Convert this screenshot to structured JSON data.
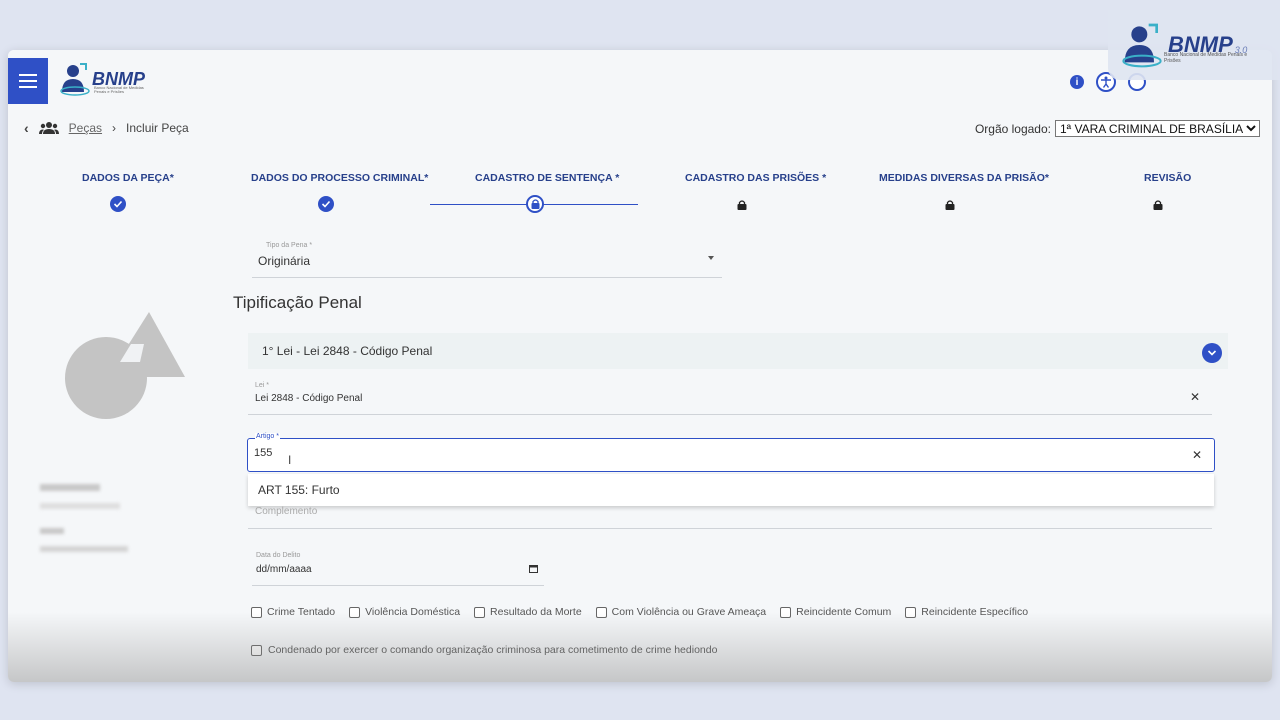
{
  "brand": {
    "name": "BNMP",
    "subtitle": "Banco Nacional de Medidas Penais e Prisões",
    "version": "3.0"
  },
  "header": {
    "info_icon": "i"
  },
  "breadcrumb": {
    "items": [
      "Peças",
      "Incluir Peça"
    ]
  },
  "orgao": {
    "label": "Orgão logado:",
    "selected": "1ª VARA CRIMINAL DE BRASÍLIA"
  },
  "stepper": {
    "steps": [
      {
        "label": "DADOS DA PEÇA*",
        "state": "done"
      },
      {
        "label": "DADOS DO PROCESSO CRIMINAL*",
        "state": "done"
      },
      {
        "label": "CADASTRO DE SENTENÇA *",
        "state": "active"
      },
      {
        "label": "CADASTRO DAS PRISÕES *",
        "state": "locked"
      },
      {
        "label": "MEDIDAS DIVERSAS DA PRISÃO*",
        "state": "locked"
      },
      {
        "label": "REVISÃO",
        "state": "locked"
      }
    ]
  },
  "form": {
    "tipo_pena": {
      "label": "Tipo da Pena *",
      "value": "Originária"
    },
    "section_title": "Tipificação Penal",
    "accordion_title": "1° Lei - Lei 2848 - Código Penal",
    "lei": {
      "label": "Lei *",
      "value": "Lei 2848 - Código Penal"
    },
    "artigo": {
      "label": "Artigo *",
      "value": "155"
    },
    "suggestion": "ART 155: Furto",
    "complemento": {
      "placeholder": "Complemento"
    },
    "data_delito": {
      "label": "Data do Delito",
      "value": "dd/mm/aaaa"
    },
    "checkboxes": [
      "Crime Tentado",
      "Violência Doméstica",
      "Resultado da Morte",
      "Com Violência ou Grave Ameaça",
      "Reincidente Comum",
      "Reincidente Específico"
    ],
    "checkbox_long": "Condenado por exercer o comando organização criminosa para cometimento de crime hediondo"
  },
  "colors": {
    "accent": "#2f50c6",
    "brand_text": "#27408b"
  }
}
